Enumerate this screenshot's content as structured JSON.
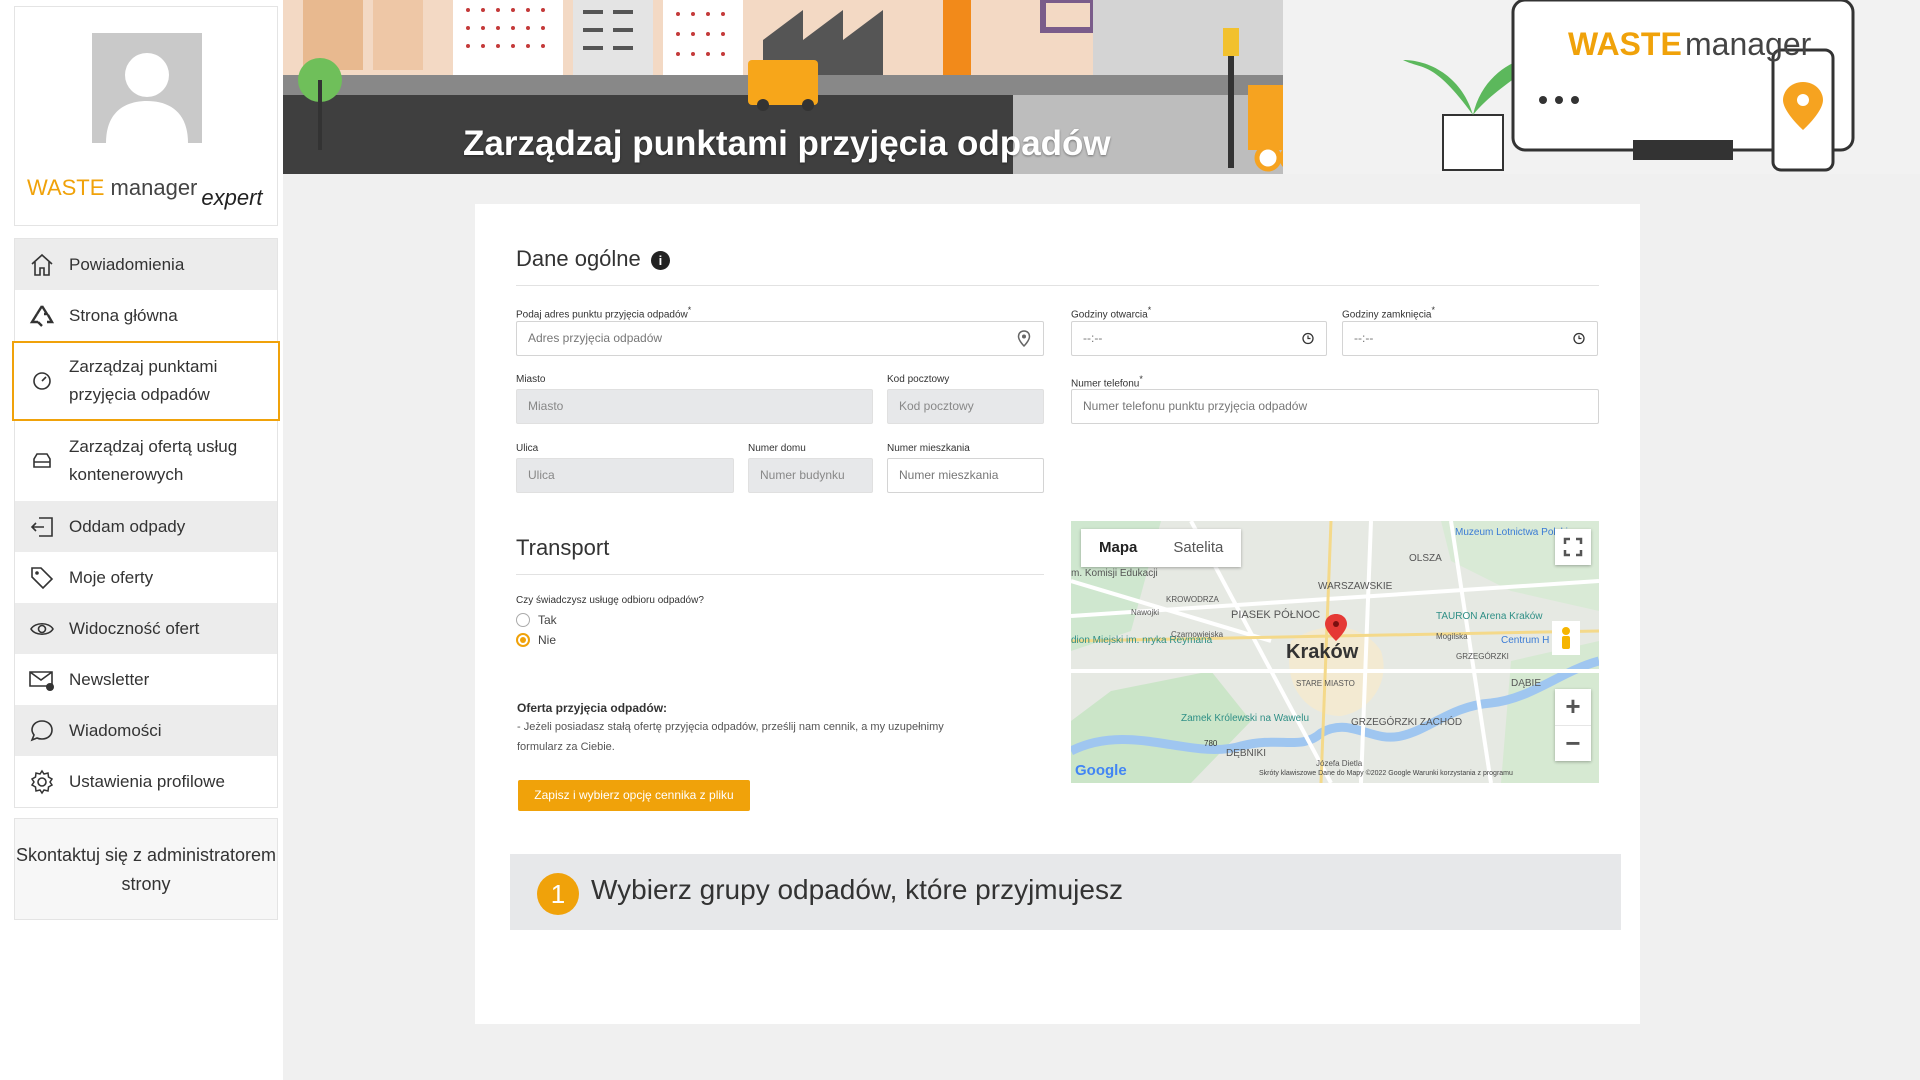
{
  "sidebar": {
    "brand": {
      "waste": "WASTE",
      "manager": "manager",
      "expert": "expert"
    },
    "items": [
      {
        "label": "Powiadomienia",
        "icon": "home-icon"
      },
      {
        "label": "Strona główna",
        "icon": "recycle-icon"
      },
      {
        "label": "Zarządzaj punktami przyjęcia odpadów",
        "icon": "gauge-icon",
        "active": true
      },
      {
        "label": "Zarządzaj ofertą usług kontenerowych",
        "icon": "container-icon"
      },
      {
        "label": "Oddam odpady",
        "icon": "logout-icon"
      },
      {
        "label": "Moje oferty",
        "icon": "tag-icon"
      },
      {
        "label": "Widoczność ofert",
        "icon": "eye-icon"
      },
      {
        "label": "Newsletter",
        "icon": "mail-icon"
      },
      {
        "label": "Wiadomości",
        "icon": "chat-icon"
      },
      {
        "label": "Ustawienia profilowe",
        "icon": "gear-icon"
      }
    ],
    "contact": "Skontaktuj się z administratorem strony"
  },
  "banner": {
    "title": "Zarządzaj punktami przyjęcia odpadów",
    "logo_waste": "WASTE",
    "logo_manager": "manager"
  },
  "general": {
    "title": "Dane ogólne",
    "address_label": "Podaj adres punktu przyjęcia odpadów",
    "address_placeholder": "Adres przyjęcia odpadów",
    "open_label": "Godziny otwarcia",
    "open_value": "--:--",
    "close_label": "Godziny zamknięcia",
    "close_value": "--:--",
    "city_label": "Miasto",
    "city_placeholder": "Miasto",
    "zip_label": "Kod pocztowy",
    "zip_placeholder": "Kod pocztowy",
    "phone_label": "Numer telefonu",
    "phone_placeholder": "Numer telefonu punktu przyjęcia odpadów",
    "street_label": "Ulica",
    "street_placeholder": "Ulica",
    "house_label": "Numer domu",
    "house_placeholder": "Numer budynku",
    "flat_label": "Numer mieszkania",
    "flat_placeholder": "Numer mieszkania",
    "required_mark": "*"
  },
  "transport": {
    "title": "Transport",
    "question": "Czy świadczysz usługę odbioru odpadów?",
    "yes": "Tak",
    "no": "Nie",
    "selected": "Nie"
  },
  "offer": {
    "title": "Oferta przyjęcia odpadów:",
    "text_line1": "- Jeżeli posiadasz stałą ofertę przyjęcia odpadów, prześlij nam cennik, a my uzupełnimy",
    "text_line2": "formularz za Ciebie.",
    "button": "Zapisz i wybierz opcję cennika z pliku"
  },
  "map": {
    "tab_map": "Mapa",
    "tab_sat": "Satelita",
    "city": "Kraków",
    "places": [
      "OLSZA",
      "WARSZAWSKIE",
      "PIASEK PÓŁNOC",
      "KROWODRZA",
      "STARE MIASTO",
      "DĄBIE",
      "GRZEGÓRZKI ZACHÓD",
      "DĘBNIKI",
      "GRZEGÓRZKI",
      "Muzeum Lotnictwa Polskiego",
      "TAURON Arena Kraków",
      "Zamek Królewski na Wawelu",
      "Centrum H",
      "m. Komisji Edukacji",
      "dion Miejski im. nryka Reymana",
      "Mogilska",
      "Nawojki",
      "Czarnowiejska",
      "Józefa Dietla"
    ],
    "road_780": "780",
    "google": "Google",
    "attribution": "Skróty klawiszowe   Dane do Mapy ©2022 Google   Warunki korzystania z programu",
    "zoom_in": "+",
    "zoom_out": "−"
  },
  "step": {
    "number": "1",
    "title": "Wybierz grupy odpadów, które przyjmujesz"
  },
  "colors": {
    "accent": "#f0a20a",
    "banner_dark": "#3e3e3e"
  }
}
